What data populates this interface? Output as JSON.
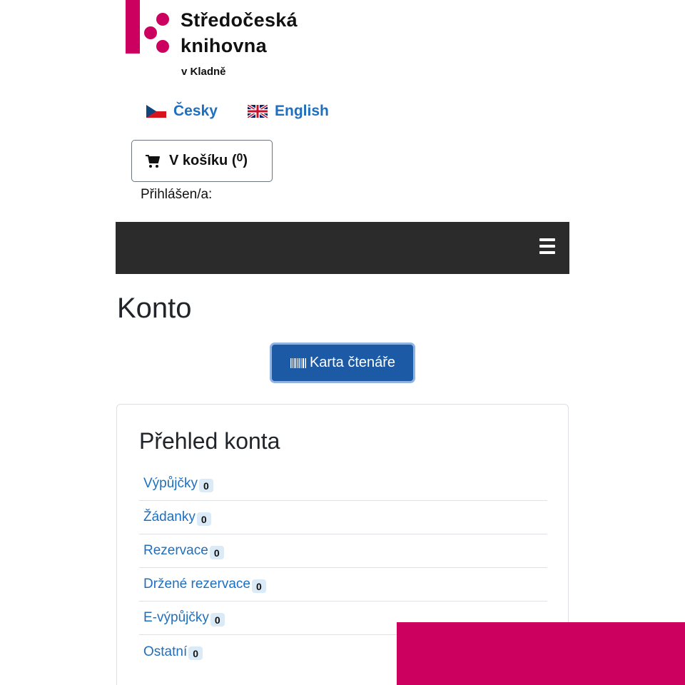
{
  "logo": {
    "line1": "Středočeská",
    "line2": "knihovna",
    "line3": "v Kladně",
    "color": "#cc005f"
  },
  "languages": [
    {
      "label": "Česky",
      "icon": "czech-flag-icon"
    },
    {
      "label": "English",
      "icon": "uk-flag-icon"
    }
  ],
  "cart": {
    "label": "V košíku (",
    "count": "0",
    "close": ")",
    "icon": "cart-icon"
  },
  "login": {
    "label": "Přihlášen/a:"
  },
  "navbar": {
    "menu_icon": "hamburger-menu-icon",
    "background": "#2b2b2b"
  },
  "page": {
    "title": "Konto"
  },
  "reader_card_button": {
    "label": "Karta čtenáře",
    "icon": "barcode-icon",
    "color": "#1d5aa6"
  },
  "overview": {
    "title": "Přehled konta",
    "items": [
      {
        "label": "Výpůjčky",
        "count": "0"
      },
      {
        "label": "Žádanky",
        "count": "0"
      },
      {
        "label": "Rezervace",
        "count": "0"
      },
      {
        "label": "Držené rezervace",
        "count": "0"
      },
      {
        "label": "E-výpůjčky",
        "count": "0"
      },
      {
        "label": "Ostatní",
        "count": "0"
      }
    ]
  }
}
